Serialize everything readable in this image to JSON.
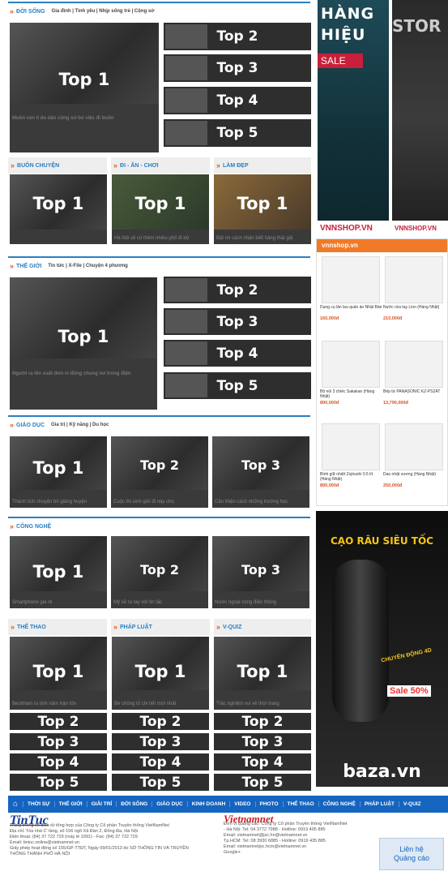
{
  "sections": {
    "doi_song": {
      "title": "ĐỜI SỐNG",
      "subs": "Gia đình | Tình yêu | Nhịp sống trẻ | Cộng sở",
      "main_caption": "Muôn vàn lí do dân công sở bỏ việc đi buôn"
    },
    "buon_chuyen": {
      "title": "BUÔN CHUYỆN"
    },
    "di_an_choi": {
      "title": "ĐI - ĂN - CHƠI",
      "caption": "Hà Nội sẽ có thêm nhiều phố đi bộ"
    },
    "lam_dep": {
      "title": "LÀM ĐẸP",
      "caption": "Bật mí cách nhận biết hàng thật giả"
    },
    "the_gioi": {
      "title": "THẾ GIỚI",
      "subs": "Tin tức | X-File | Chuyện 4 phương",
      "main_caption": "Người ra lên xuất đơn vì đồng chung nơ trong điện"
    },
    "giao_duc": {
      "title": "GIÁO DỤC",
      "subs": "Gia trị | Kỹ năng | Du học",
      "captions": [
        "Thành tích chuyện bỏ giảng huyện",
        "Cuộc thi sinh giỏi đi này cho",
        "Cần thiện cách những trường học"
      ]
    },
    "cong_nghe": {
      "title": "CÔNG NGHỆ",
      "captions": [
        "Smartphone giá rẻ",
        "Mỹ sẽ ra tay với tin tặc",
        "Nước ngoài cộng điện thông"
      ]
    },
    "the_thao": {
      "title": "THỂ THAO",
      "caption": "Beckham ra tính nắm trận tôn"
    },
    "phap_luat": {
      "title": "PHÁP LUẬT",
      "caption": "Bé chồng tố chi tiết mới nhất"
    },
    "v_quiz": {
      "title": "V-QUIZ",
      "caption": "Trắc nghiệm vui về thời trang"
    }
  },
  "labels": {
    "top1": "Top 1",
    "top2": "Top 2",
    "top3": "Top 3",
    "top4": "Top 4",
    "top5": "Top 5"
  },
  "ads": {
    "hang_hieu_line1": "HÀNG",
    "hang_hieu_line2": "HIỆU",
    "sale": "SALE",
    "vnshop": "VNNSHOP.VN",
    "vnshop2": "VNNSHOP.VN",
    "store": "STOR",
    "vnshop_box": "vnnshop.vn",
    "products": [
      {
        "name": "Dụng cụ lăn lau quần áo Nhật Bản",
        "price": "160,000đ"
      },
      {
        "name": "Nước rửa tay Lion (Hàng Nhật)",
        "price": "210,000đ"
      },
      {
        "name": "Bộ nồi 3 chiếc Sakakan (Hàng Nhật)",
        "price": "890,000đ"
      },
      {
        "name": "Bếp từ PANASONIC KZ-PS2AT",
        "price": "13,790,000đ"
      },
      {
        "name": "Bình giữ nhiệt Zojirushi 0.5 lít (Hàng Nhật)",
        "price": "890,000đ"
      },
      {
        "name": "Dao nhật vương (Hàng Nhật)",
        "price": "250,000đ"
      }
    ],
    "razor_title": "CẠO RÂU SIÊU TỐC",
    "razor_tag": "CHUYỂN ĐỘNG 4D",
    "razor_sale": "Sale 50%",
    "baza": "baza.vn"
  },
  "nav": {
    "items": [
      "THỜI SỰ",
      "THẾ GIỚI",
      "GIẢI TRÍ",
      "ĐỜI SỐNG",
      "GIÁO DỤC",
      "KINH DOANH",
      "VIDEO",
      "PHOTO",
      "THỂ THAO",
      "CÔNG NGHỆ",
      "PHÁP LUẬT",
      "V-QUIZ"
    ]
  },
  "footer": {
    "logo_left": "TinTuc",
    "left_lines": [
      "Trang thông tin điện tử tổng hợp của Công ty Cổ phần Truyền thông VietNamNet",
      "Địa chỉ: Tòa nhà C' tầng, số 156 ngõ Xã Đàn 2, Đống Đa, Hà Nội",
      "Điện thoại: (84) 37 722 729 (máy lẻ 1991) - Fax: (84) 37 722 729",
      "Email: tintuc.online@vietnamnet.vn",
      "Giấy phép hoạt động số 155/GP-TTĐT, Ngày 09/01/2013 do SỞ THÔNG TIN VÀ TRUYỀN",
      "THÔNG THÀNH PHỐ HÀ NỘI"
    ],
    "logo_right": "Vietnamnet",
    "right_lines": [
      "Đơn vị quảng cáo: Công ty Cổ phần Truyền thông VietNamNet",
      "- Hà Nội: Tel: 04 3772 7988 - Hotline: 0919 405 885",
      "Email: vietnamnet@jsc.hn@vietnamnet.vn",
      "Tp.HCM: Tel: 08 3930 6885 - Hotline: 0919 435 885",
      "Email: vietnamnetjsc.hcm@vietnamnet.vn",
      "Google+"
    ],
    "contact_line1": "Liên hệ",
    "contact_line2": "Quảng cáo"
  }
}
